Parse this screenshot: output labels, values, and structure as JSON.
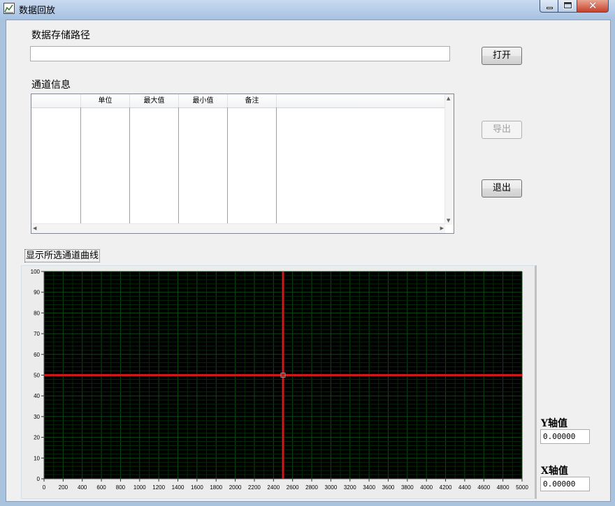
{
  "window": {
    "title": "数据回放",
    "icon": "chart-app-icon",
    "controls": {
      "minimize": "minimize-icon",
      "maximize": "maximize-icon",
      "close": "close-icon"
    }
  },
  "storage": {
    "label": "数据存储路径",
    "path_value": "",
    "open_button": "打开"
  },
  "channels": {
    "label": "通道信息",
    "columns": [
      "",
      "单位",
      "最大值",
      "最小值",
      "备注"
    ],
    "rows": []
  },
  "actions": {
    "export_button": "导出",
    "exit_button": "退出"
  },
  "plot_group": {
    "label": "显示所选通道曲线"
  },
  "readouts": {
    "y_label": "Y轴值",
    "y_value": "0.00000",
    "x_label": "X轴值",
    "x_value": "0.00000"
  },
  "chart_data": {
    "type": "line",
    "title": "",
    "xlabel": "",
    "ylabel": "",
    "xlim": [
      0,
      5000
    ],
    "ylim": [
      0,
      100
    ],
    "x_ticks": [
      0,
      200,
      400,
      600,
      800,
      1000,
      1200,
      1400,
      1600,
      1800,
      2000,
      2200,
      2400,
      2600,
      2800,
      3000,
      3200,
      3400,
      3600,
      3800,
      4000,
      4200,
      4400,
      4600,
      4800,
      5000
    ],
    "y_ticks": [
      0,
      10,
      20,
      30,
      40,
      50,
      60,
      70,
      80,
      90,
      100
    ],
    "series": [],
    "background": "#000000",
    "grid": true,
    "grid_color": "#0b4a12",
    "cursor": {
      "x": 2500,
      "y": 50,
      "color": "#d01818"
    }
  }
}
